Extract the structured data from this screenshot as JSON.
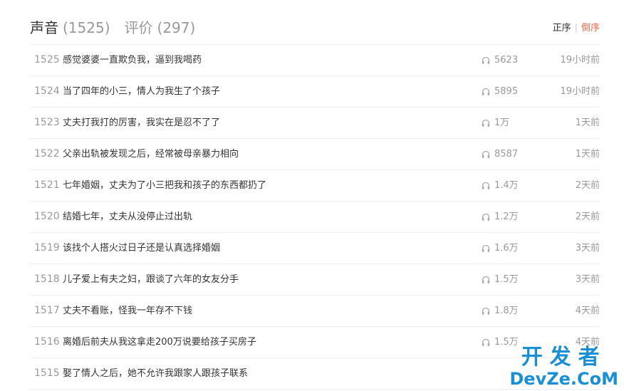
{
  "tabs": [
    {
      "label": "声音",
      "count": "(1525)",
      "active": true
    },
    {
      "label": "评价",
      "count": "(297)",
      "active": false
    }
  ],
  "sort": {
    "asc_label": "正序",
    "separator": "|",
    "desc_label": "倒序",
    "active_color": "#f86442"
  },
  "icons": {
    "plays": "headphones-icon"
  },
  "tracks": [
    {
      "index": "1525",
      "title": "感觉婆婆一直欺负我，逼到我喝药",
      "plays": "5623",
      "time": "19小时前"
    },
    {
      "index": "1524",
      "title": "当了四年的小三，情人为我生了个孩子",
      "plays": "5895",
      "time": "19小时前"
    },
    {
      "index": "1523",
      "title": "丈夫打我打的厉害，我实在是忍不了了",
      "plays": "1万",
      "time": "1天前"
    },
    {
      "index": "1522",
      "title": "父亲出轨被发现之后，经常被母亲暴力相向",
      "plays": "8587",
      "time": "1天前"
    },
    {
      "index": "1521",
      "title": "七年婚姻，丈夫为了小三把我和孩子的东西都扔了",
      "plays": "1.4万",
      "time": "2天前"
    },
    {
      "index": "1520",
      "title": "结婚七年，丈夫从没停止过出轨",
      "plays": "1.2万",
      "time": "2天前"
    },
    {
      "index": "1519",
      "title": "该找个人搭火过日子还是认真选择婚姻",
      "plays": "1.6万",
      "time": "3天前"
    },
    {
      "index": "1518",
      "title": "儿子爱上有夫之妇，跟谈了六年的女友分手",
      "plays": "1.5万",
      "time": "3天前"
    },
    {
      "index": "1517",
      "title": "丈夫不看账，怪我一年存不下钱",
      "plays": "1.8万",
      "time": "4天前"
    },
    {
      "index": "1516",
      "title": "离婚后前夫从我这拿走200万说要给孩子买房子",
      "plays": "1.5万",
      "time": "4天前"
    },
    {
      "index": "1515",
      "title": "娶了情人之后，她不允许我跟家人跟孩子联系",
      "plays": "",
      "time": ""
    }
  ],
  "watermark": {
    "top": "开发者",
    "bottom": "DevZe.CoM"
  }
}
